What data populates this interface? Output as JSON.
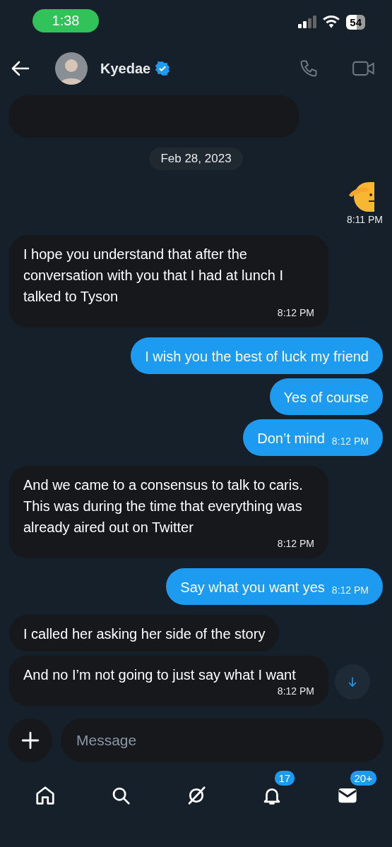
{
  "status_bar": {
    "time": "1:38",
    "battery": "54"
  },
  "header": {
    "name": "Kyedae",
    "verified": true
  },
  "messages": [
    {
      "kind": "cut",
      "outgoing": false
    },
    {
      "kind": "date",
      "text": "Feb 28, 2023"
    },
    {
      "kind": "emoji",
      "outgoing": true,
      "time": "8:11 PM"
    },
    {
      "kind": "text",
      "outgoing": false,
      "text": "I hope you understand that after the conversation with you that I had at lunch I talked to Tyson",
      "time": "8:12 PM"
    },
    {
      "kind": "text",
      "outgoing": true,
      "text": "I wish you the best of luck my friend"
    },
    {
      "kind": "text",
      "outgoing": true,
      "text": "Yes of course"
    },
    {
      "kind": "text",
      "outgoing": true,
      "text": "Don’t mind",
      "time": "8:12 PM"
    },
    {
      "kind": "text",
      "outgoing": false,
      "text": "And we came to a consensus to talk to caris. This was during the time that everything was already aired out on Twitter",
      "time": "8:12 PM"
    },
    {
      "kind": "text",
      "outgoing": true,
      "text": "Say what you want yes",
      "time": "8:12 PM"
    },
    {
      "kind": "text",
      "outgoing": false,
      "text": "I called her asking her side of the story"
    },
    {
      "kind": "text",
      "outgoing": false,
      "text": "And no I’m not going to just say what I want",
      "time": "8:12 PM"
    }
  ],
  "composer": {
    "placeholder": "Message"
  },
  "nav": [
    {
      "kind": "home",
      "selected": false
    },
    {
      "kind": "search",
      "selected": false
    },
    {
      "kind": "grok",
      "selected": false
    },
    {
      "kind": "bell",
      "selected": false,
      "badge": "17"
    },
    {
      "kind": "mail",
      "selected": true,
      "badge": "20+"
    }
  ]
}
